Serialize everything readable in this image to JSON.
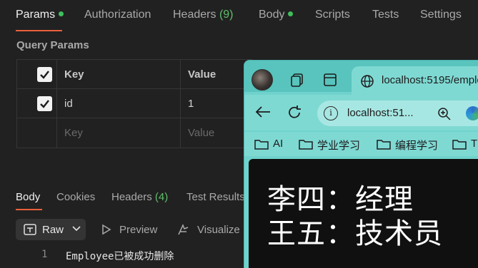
{
  "request_tabs": [
    {
      "label": "Params",
      "count": "",
      "dot": true
    },
    {
      "label": "Authorization",
      "count": "",
      "dot": false
    },
    {
      "label": "Headers",
      "count": "(9)",
      "dot": false
    },
    {
      "label": "Body",
      "count": "",
      "dot": true
    },
    {
      "label": "Scripts",
      "count": "",
      "dot": false
    },
    {
      "label": "Tests",
      "count": "",
      "dot": false
    },
    {
      "label": "Settings",
      "count": "",
      "dot": false
    }
  ],
  "query_params": {
    "title": "Query Params",
    "columns": [
      "Key",
      "Value"
    ],
    "rows": [
      {
        "checked": true,
        "key": "id",
        "value": "1"
      }
    ],
    "placeholder": {
      "key": "Key",
      "value": "Value"
    }
  },
  "response_tabs": [
    {
      "label": "Body",
      "count": ""
    },
    {
      "label": "Cookies",
      "count": ""
    },
    {
      "label": "Headers",
      "count": "(4)"
    },
    {
      "label": "Test Results",
      "count": ""
    }
  ],
  "response_toolbar": {
    "format": "Raw",
    "preview": "Preview",
    "visualize": "Visualize"
  },
  "response_body": [
    {
      "line": "1",
      "text": "Employee已被成功删除"
    }
  ],
  "browser": {
    "tab_title": "localhost:5195/emplo",
    "address": "localhost:51...",
    "bookmarks": [
      "AI",
      "学业学习",
      "编程学习",
      "T"
    ],
    "content_lines": [
      "李四：经理",
      "王五：技术员"
    ]
  },
  "colors": {
    "accent": "#e8603c",
    "success": "#3fbf5c",
    "browser_frame": "#70d2cc"
  }
}
